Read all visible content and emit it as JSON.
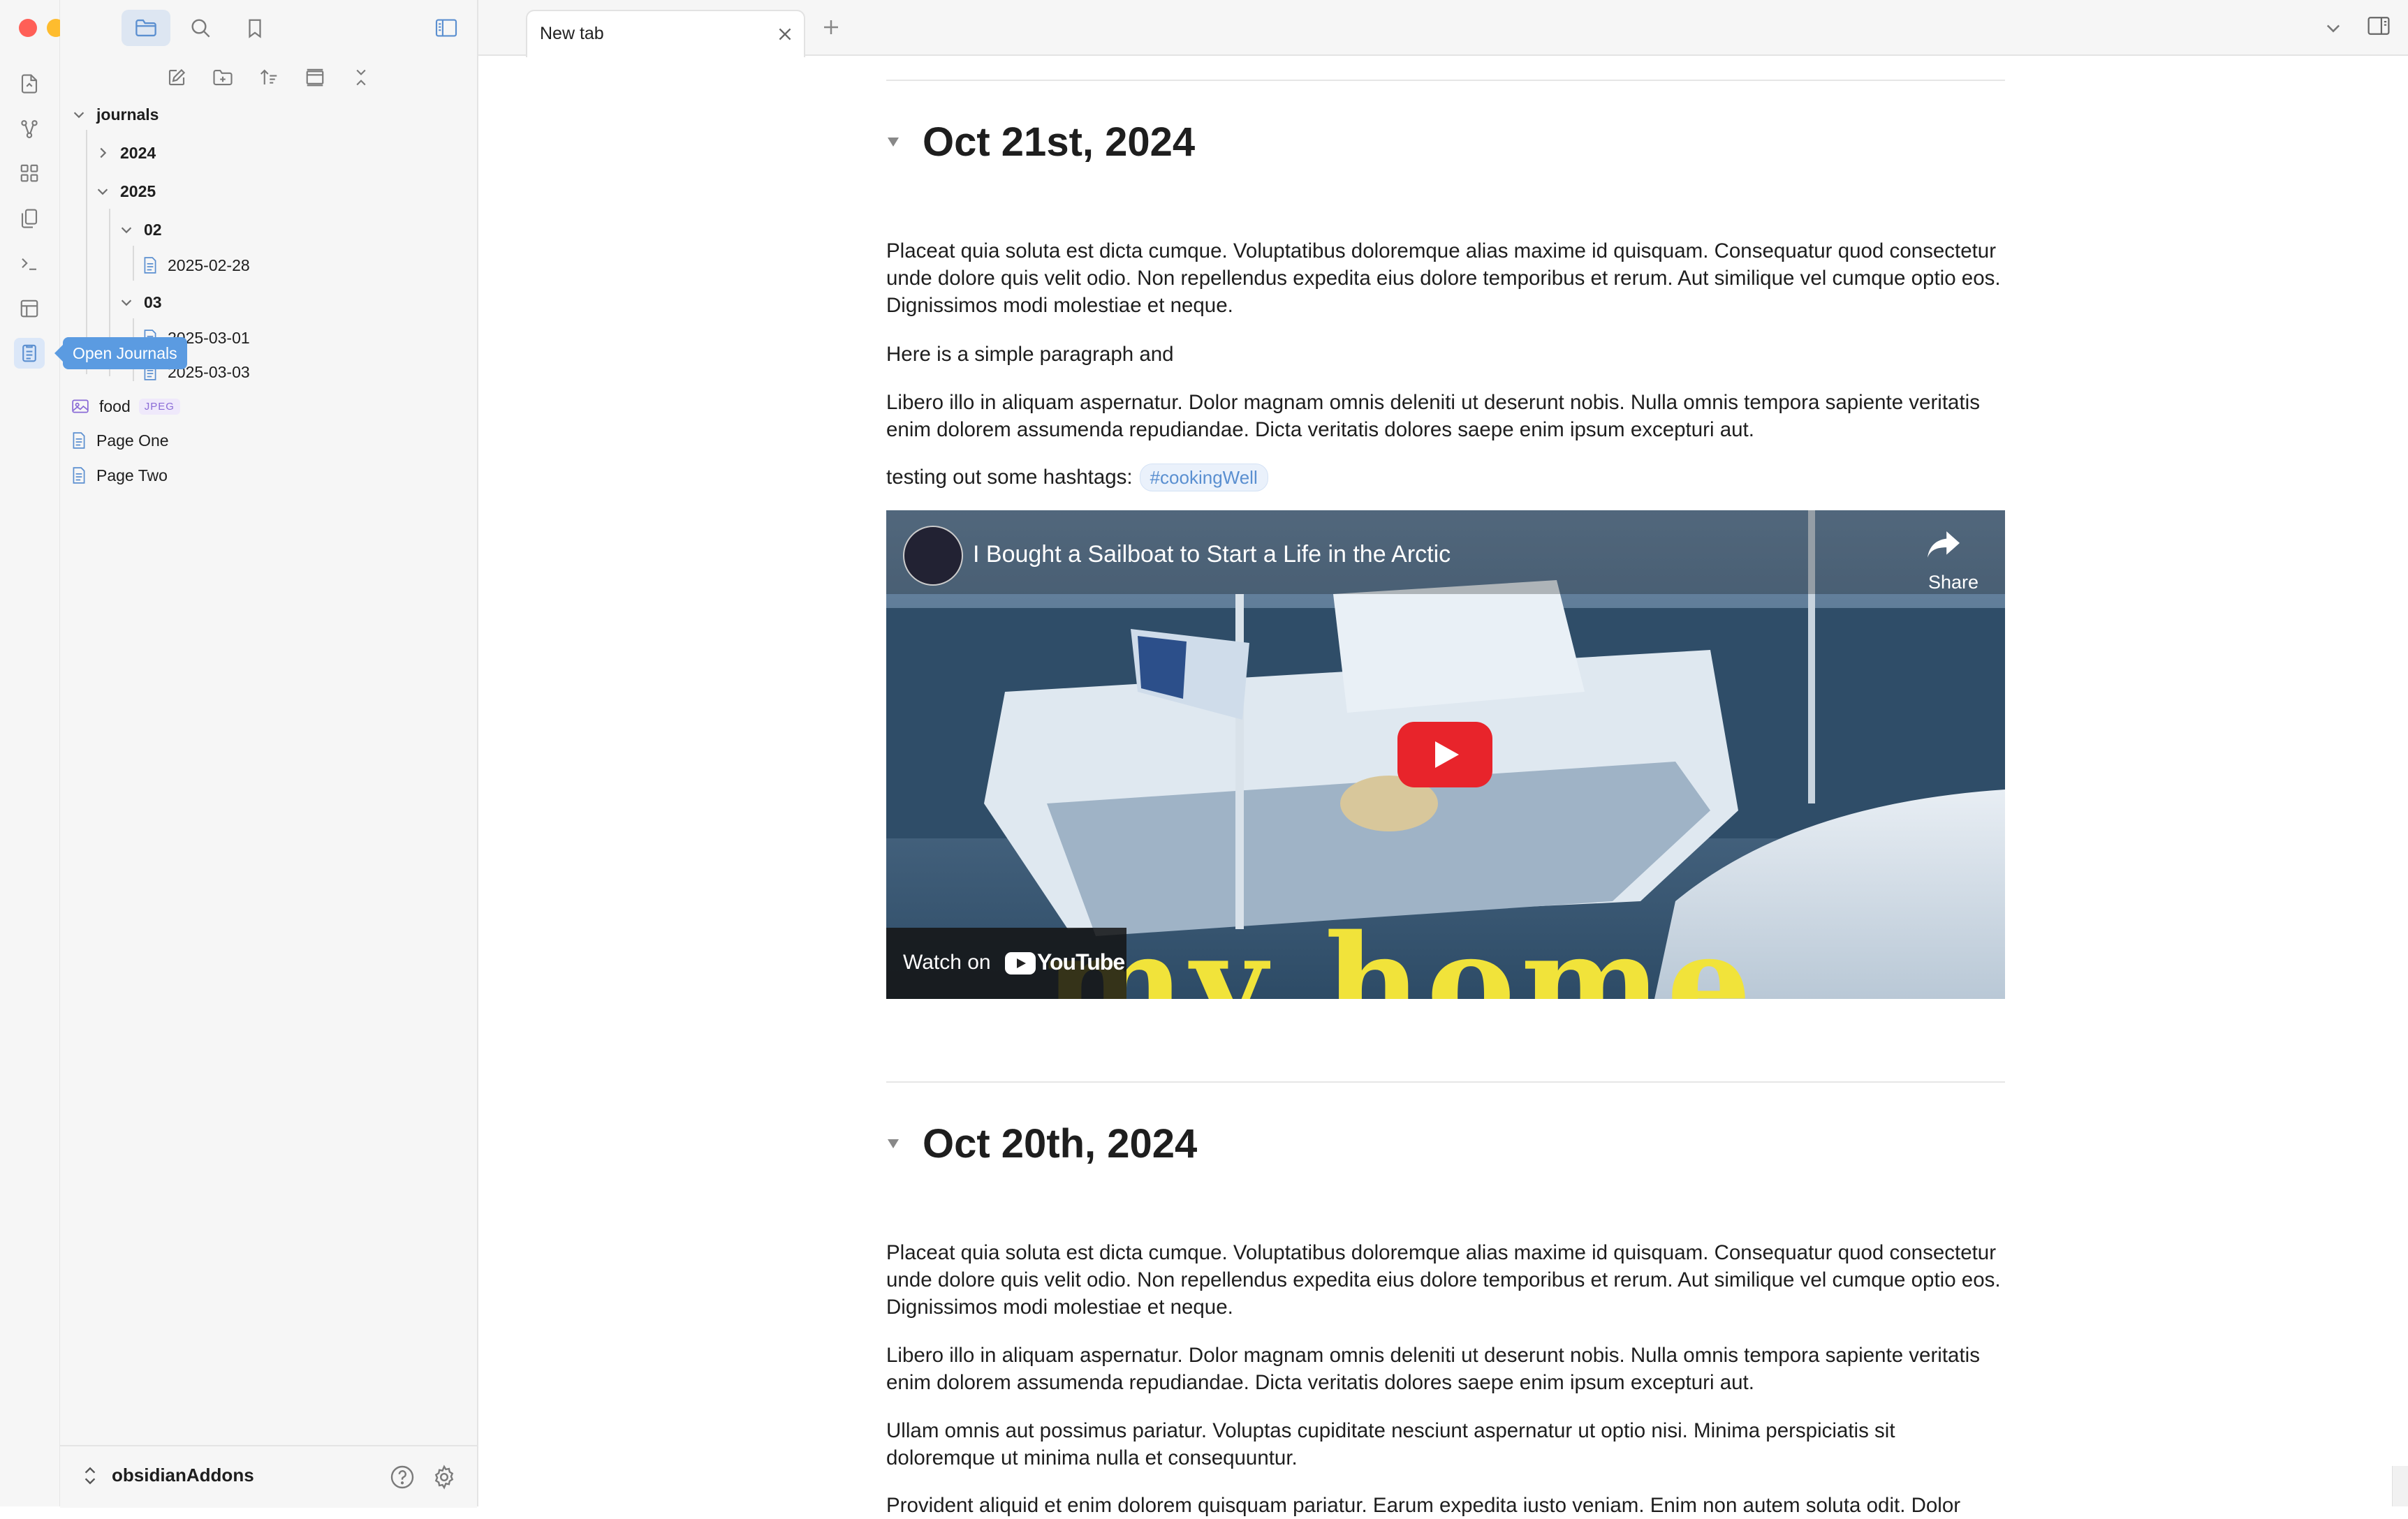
{
  "window": {
    "traffic_colors": {
      "close": "#ff5f57",
      "minimize": "#febc2e",
      "zoom": "#28c840"
    }
  },
  "ribbon": {
    "icons": [
      "open-quick-switcher-icon",
      "graph-view-icon",
      "canvas-icon",
      "templates-icon",
      "command-palette-icon",
      "bases-icon",
      "open-journals-icon"
    ],
    "tooltip": "Open Journals"
  },
  "sidebar": {
    "top_buttons": [
      "files-icon",
      "search-icon",
      "bookmark-icon"
    ],
    "actions": [
      "new-note-icon",
      "new-folder-icon",
      "sort-icon",
      "auto-reveal-icon",
      "collapse-all-icon"
    ],
    "tree": {
      "journals": "journals",
      "y2024": "2024",
      "y2025": "2025",
      "m02": "02",
      "f0228": "2025-02-28",
      "m03": "03",
      "f0301": "2025-03-01",
      "f0303": "2025-03-03",
      "food": "food",
      "food_badge": "JPEG",
      "page_one": "Page One",
      "page_two": "Page Two"
    },
    "vault_name": "obsidianAddons"
  },
  "tabs": {
    "active_title": "New tab"
  },
  "content": {
    "entry1": {
      "heading": "Oct 21st, 2024",
      "p1": "Placeat quia soluta est dicta cumque. Voluptatibus doloremque alias maxime id quisquam. Consequatur quod consectetur unde dolore quis velit odio. Non repellendus expedita eius dolore temporibus et rerum. Aut similique vel cumque optio eos. Dignissimos modi molestiae et neque.",
      "p2": "Here is a simple paragraph and",
      "p3": "Libero illo in aliquam aspernatur. Dolor magnam omnis deleniti ut deserunt nobis. Nulla omnis tempora sapiente veritatis enim dolorem assumenda repudiandae. Dicta veritatis dolores saepe enim ipsum excepturi aut.",
      "p4": "testing out some hashtags:",
      "tag": "#cookingWell",
      "video": {
        "title": "I Bought a Sailboat to Start a Life in the Arctic",
        "share": "Share",
        "watch_on": "Watch on",
        "youtube": "YouTube",
        "overlay": "my home"
      }
    },
    "entry2": {
      "heading": "Oct 20th, 2024",
      "p1": "Placeat quia soluta est dicta cumque. Voluptatibus doloremque alias maxime id quisquam. Consequatur quod consectetur unde dolore quis velit odio. Non repellendus expedita eius dolore temporibus et rerum. Aut similique vel cumque optio eos. Dignissimos modi molestiae et neque.",
      "p2": "Libero illo in aliquam aspernatur. Dolor magnam omnis deleniti ut deserunt nobis. Nulla omnis tempora sapiente veritatis enim dolorem assumenda repudiandae. Dicta veritatis dolores saepe enim ipsum excepturi aut.",
      "p3": "Ullam omnis aut possimus pariatur. Voluptas cupiditate nesciunt aspernatur ut optio nisi. Minima perspiciatis sit doloremque ut minima nulla et consequuntur.",
      "p4": "Provident aliquid et enim dolorem quisquam pariatur. Earum expedita iusto veniam. Enim non autem soluta odit. Dolor"
    }
  }
}
